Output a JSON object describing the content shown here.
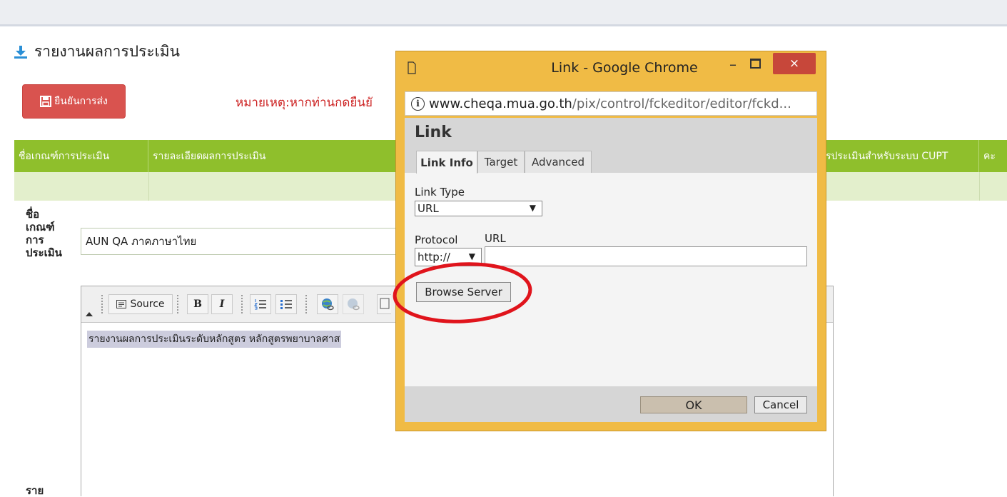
{
  "page": {
    "heading": "รายงานผลการประเมิน",
    "confirm_button": "ยืนยันการส่ง",
    "note": "หมายเหตุ:หากท่านกดยืนยั"
  },
  "table": {
    "headers": [
      "ชื่อเกณฑ์การประเมิน",
      "รายละเอียดผลการประเมิน",
      "รประเมินสำหรับระบบ CUPT",
      "คะ"
    ]
  },
  "form": {
    "criteria_label": "ชื่อ เกณฑ์ การ ประเมิน",
    "criteria_value": "AUN QA ภาคภาษาไทย",
    "detail_label": "ราย"
  },
  "editor": {
    "source_label": "Source",
    "bold_label": "B",
    "italic_label": "I",
    "content_text": "รายงานผลการประเมินระดับหลักสูตร หลักสูตรพยาบาลศาส"
  },
  "dialog": {
    "window_title": "Link - Google Chrome",
    "close_label": "×",
    "url_host": "www.cheqa.mua.go.th",
    "url_path": "/pix/control/fckeditor/editor/fckd...",
    "heading": "Link",
    "tabs": [
      {
        "label": "Link Info",
        "active": true
      },
      {
        "label": "Target",
        "active": false
      },
      {
        "label": "Advanced",
        "active": false
      }
    ],
    "link_type_label": "Link Type",
    "link_type_value": "URL",
    "protocol_label": "Protocol",
    "protocol_value": "http://",
    "url_label": "URL",
    "url_value": "",
    "browse_button": "Browse Server",
    "ok_button": "OK",
    "cancel_button": "Cancel"
  },
  "colors": {
    "header_green": "#8fbf2c",
    "danger_red": "#d9534f",
    "window_frame": "#f0bb45",
    "highlight_ring": "#e0141c"
  }
}
